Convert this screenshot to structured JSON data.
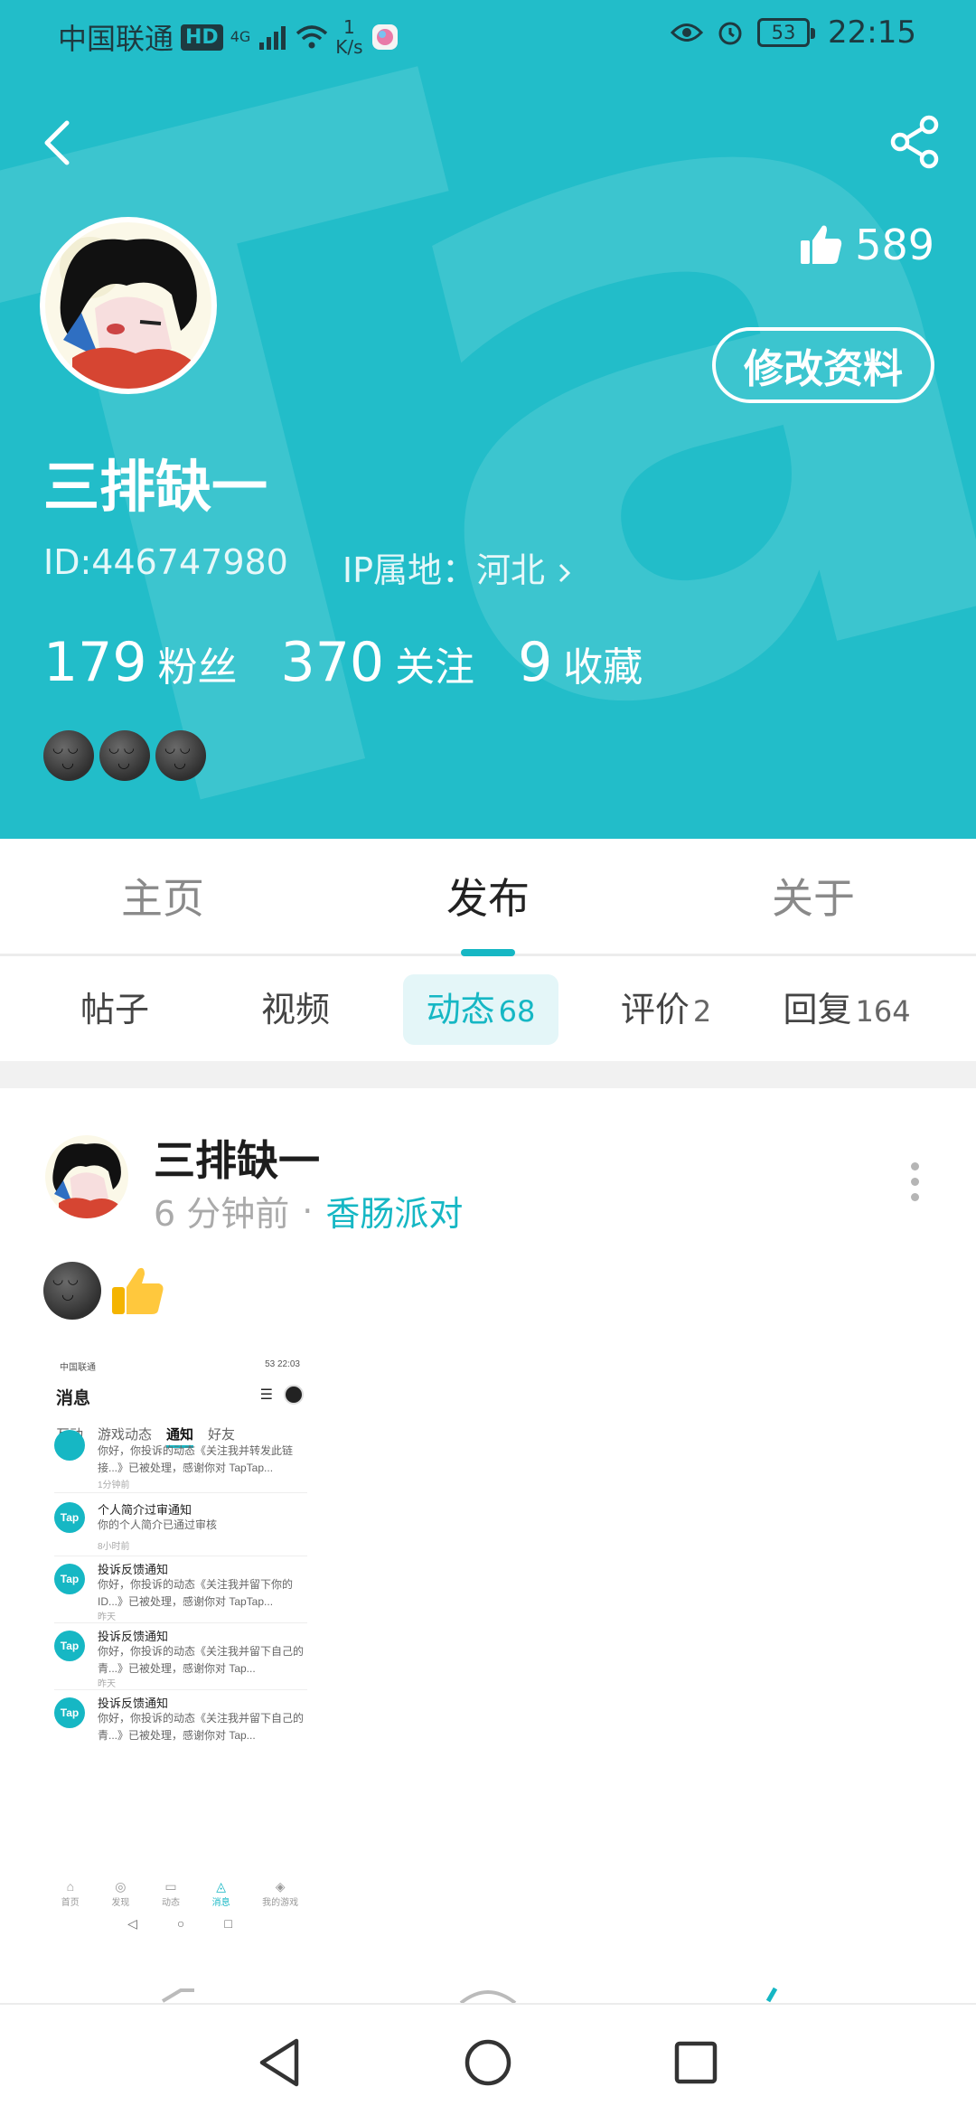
{
  "status_bar": {
    "carrier": "中国联通",
    "hd": "HD",
    "network": "4G",
    "speed_value": "1",
    "speed_unit": "K/s",
    "battery": "53",
    "time": "22:15"
  },
  "profile": {
    "nickname": "三排缺一",
    "id_text": "ID:446747980",
    "ip_text": "IP属地：河北",
    "likes": "589",
    "edit_label": "修改资料",
    "stats": [
      {
        "num": "179",
        "label": "粉丝"
      },
      {
        "num": "370",
        "label": "关注"
      },
      {
        "num": "9",
        "label": "收藏"
      }
    ]
  },
  "tabs": [
    "主页",
    "发布",
    "关于"
  ],
  "active_tab": "发布",
  "subtabs": [
    {
      "label": "帖子",
      "count": ""
    },
    {
      "label": "视频",
      "count": ""
    },
    {
      "label": "动态",
      "count": "68"
    },
    {
      "label": "评价",
      "count": "2"
    },
    {
      "label": "回复",
      "count": "164"
    }
  ],
  "post": {
    "author": "三排缺一",
    "time": "6 分钟前",
    "separator": "·",
    "game": "香肠派对"
  },
  "screenshot": {
    "status_left": "中国联通",
    "status_right": "53 22:03",
    "title": "消息",
    "tabs": [
      "互动",
      "游戏动态",
      "通知",
      "好友"
    ],
    "items": [
      {
        "title": "",
        "body": "你好，你投诉的动态《关注我并转发此链接...》已被处理，感谢你对 TapTap...",
        "time": "1分钟前"
      },
      {
        "title": "个人简介过审通知",
        "body": "你的个人简介已通过审核",
        "time": "8小时前"
      },
      {
        "title": "投诉反馈通知",
        "body": "你好，你投诉的动态《关注我并留下你的ID...》已被处理，感谢你对 TapTap...",
        "time": "昨天"
      },
      {
        "title": "投诉反馈通知",
        "body": "你好，你投诉的动态《关注我并留下自己的青...》已被处理，感谢你对 Tap...",
        "time": "昨天"
      },
      {
        "title": "投诉反馈通知",
        "body": "你好，你投诉的动态《关注我并留下自己的青...》已被处理，感谢你对 Tap...",
        "time": ""
      }
    ],
    "tap_logo": "Tap",
    "nav": [
      "首页",
      "发现",
      "动态",
      "消息",
      "我的游戏"
    ]
  },
  "colors": {
    "header_bg": "#22bdc9",
    "accent": "#16b7c4"
  }
}
